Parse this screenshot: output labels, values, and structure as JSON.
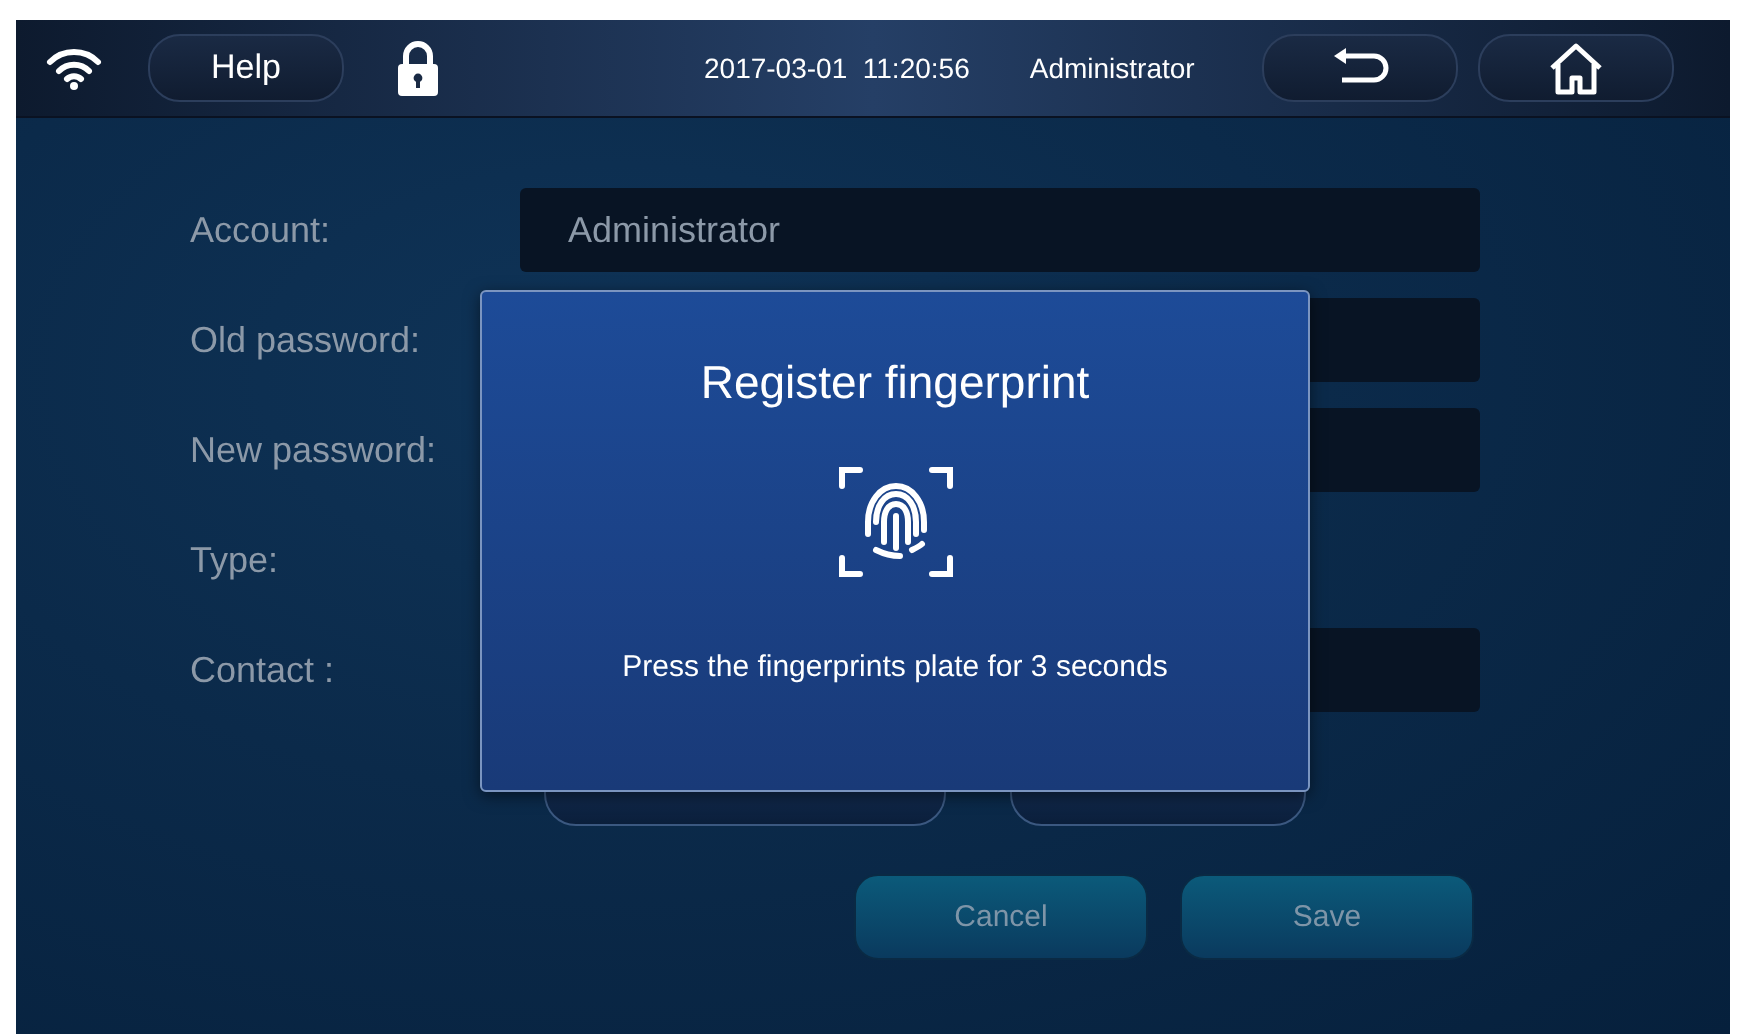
{
  "top_bar": {
    "help_button": "Help",
    "datetime": "2017-03-01  11:20:56",
    "user": "Administrator"
  },
  "form": {
    "rows": [
      {
        "label": "Account:",
        "kind": "field",
        "value": "Administrator"
      },
      {
        "label": "Old password:",
        "kind": "field"
      },
      {
        "label": "New password:",
        "kind": "field"
      },
      {
        "label": "Type:",
        "kind": "none"
      },
      {
        "label": "Contact :",
        "kind": "field"
      }
    ],
    "buttons": [
      "Cancel",
      "Save"
    ]
  },
  "dialog": {
    "title": "Register fingerprint",
    "message": "Press the fingerprints plate for 3 seconds"
  }
}
